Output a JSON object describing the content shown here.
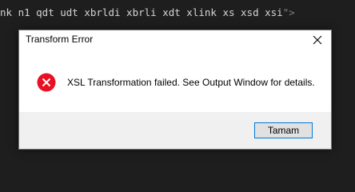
{
  "editor": {
    "code_text": "nk n1 qdt udt xbrldi xbrli xdt xlink xs xsd xsi",
    "closing": "\">"
  },
  "dialog": {
    "title": "Transform Error",
    "message": "XSL Transformation failed. See Output Window for details.",
    "ok_label": "Tamam",
    "icon": "error-icon",
    "close_icon": "close-icon"
  },
  "colors": {
    "error_red": "#e81123",
    "accent": "#0078d7",
    "footer_bg": "#f0f0f0",
    "editor_bg": "#1e1e1e"
  }
}
